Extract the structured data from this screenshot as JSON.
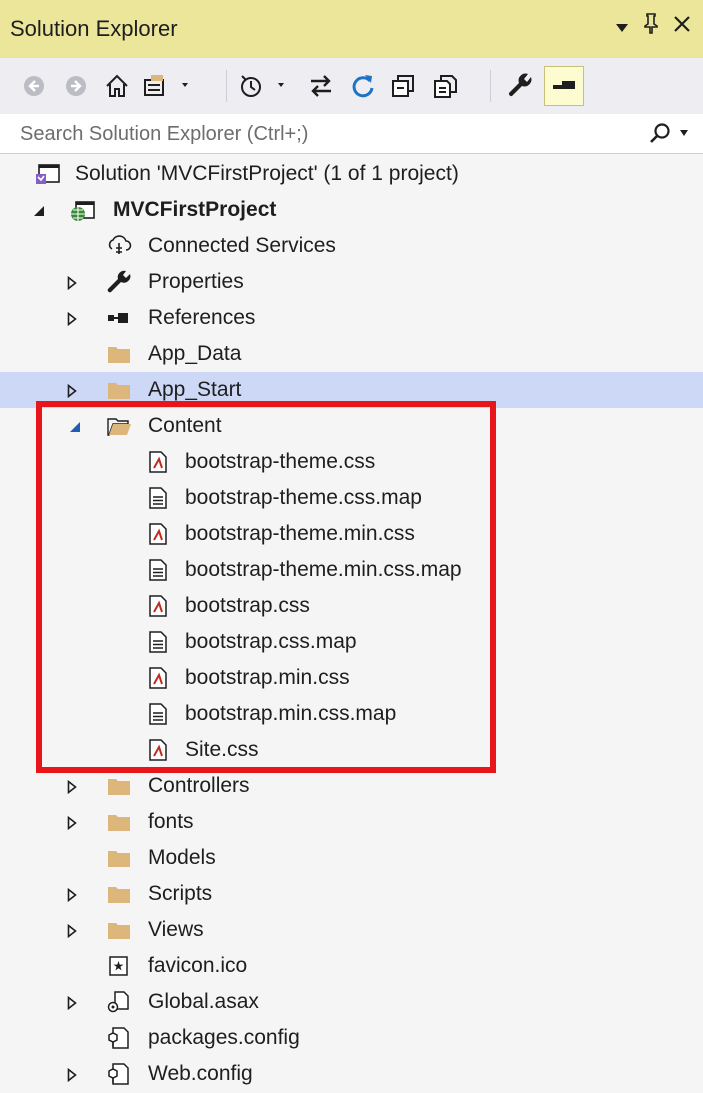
{
  "window": {
    "title": "Solution Explorer",
    "dropdown_icon": "triangle-down-icon",
    "pin_icon": "pin-icon",
    "close_icon": "close-icon"
  },
  "toolbar": {
    "buttons": [
      "back-icon",
      "forward-icon",
      "home-icon",
      "switch-views-icon",
      "pending-changes-icon",
      "sync-icon",
      "refresh-icon",
      "collapse-all-icon",
      "show-all-files-icon",
      "properties-icon",
      "preview-icon"
    ]
  },
  "search": {
    "placeholder": "Search Solution Explorer (Ctrl+;)"
  },
  "tree": {
    "solution": "Solution 'MVCFirstProject' (1 of 1 project)",
    "project": "MVCFirstProject",
    "connected_services": "Connected Services",
    "properties": "Properties",
    "references": "References",
    "app_data": "App_Data",
    "app_start": "App_Start",
    "content": "Content",
    "content_files": [
      "bootstrap-theme.css",
      "bootstrap-theme.css.map",
      "bootstrap-theme.min.css",
      "bootstrap-theme.min.css.map",
      "bootstrap.css",
      "bootstrap.css.map",
      "bootstrap.min.css",
      "bootstrap.min.css.map",
      "Site.css"
    ],
    "controllers": "Controllers",
    "fonts": "fonts",
    "models": "Models",
    "scripts": "Scripts",
    "views": "Views",
    "favicon": "favicon.ico",
    "global": "Global.asax",
    "packages": "packages.config",
    "webconfig": "Web.config"
  },
  "colors": {
    "title_bg": "#ebe69a",
    "selected_row": "#ccd8f5",
    "folder": "#dcb67a",
    "highlight": "#e8151b"
  }
}
